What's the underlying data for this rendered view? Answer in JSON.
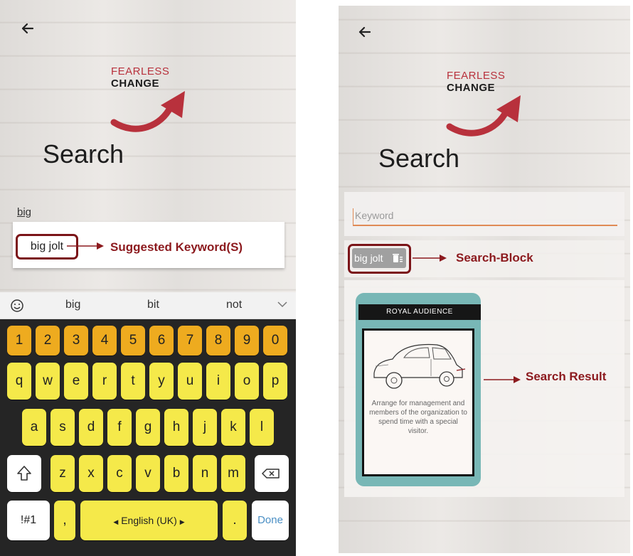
{
  "left_screen": {
    "logo": {
      "word1": "FEARLESS",
      "word2": "CHANGE"
    },
    "title": "Search",
    "input_value": "big",
    "suggestion": "big jolt",
    "annotation": "Suggested Keyword(S)",
    "keyboard": {
      "suggestions": [
        "big",
        "bit",
        "not"
      ],
      "row_numbers": [
        "1",
        "2",
        "3",
        "4",
        "5",
        "6",
        "7",
        "8",
        "9",
        "0"
      ],
      "row1": [
        "q",
        "w",
        "e",
        "r",
        "t",
        "y",
        "u",
        "i",
        "o",
        "p"
      ],
      "row2": [
        "a",
        "s",
        "d",
        "f",
        "g",
        "h",
        "j",
        "k",
        "l"
      ],
      "row3": [
        "z",
        "x",
        "c",
        "v",
        "b",
        "n",
        "m"
      ],
      "symbols_key": "!#1",
      "comma_key": ",",
      "space_key": "English (UK)",
      "period_key": ".",
      "done_key": "Done"
    }
  },
  "right_screen": {
    "logo": {
      "word1": "FEARLESS",
      "word2": "CHANGE"
    },
    "title": "Search",
    "keyword_placeholder": "Keyword",
    "search_block_chip": "big jolt",
    "annotation_block": "Search-Block",
    "annotation_result": "Search Result",
    "card": {
      "title": "ROYAL AUDIENCE",
      "description": "Arrange for management and members of the organization to spend time with a special visitor."
    }
  },
  "colors": {
    "accent_red": "#b8313c",
    "annotation_red": "#8c1a1e",
    "frame_maroon": "#7b1418",
    "input_underline": "#e08a55",
    "key_yellow": "#f5e94a",
    "key_orange": "#eeab1f",
    "card_teal": "#78b7b6"
  },
  "icons": [
    "back-arrow-icon",
    "emoji-icon",
    "chevron-down-icon",
    "shift-icon",
    "backspace-icon",
    "trash-icon",
    "arrow-right-icon"
  ]
}
